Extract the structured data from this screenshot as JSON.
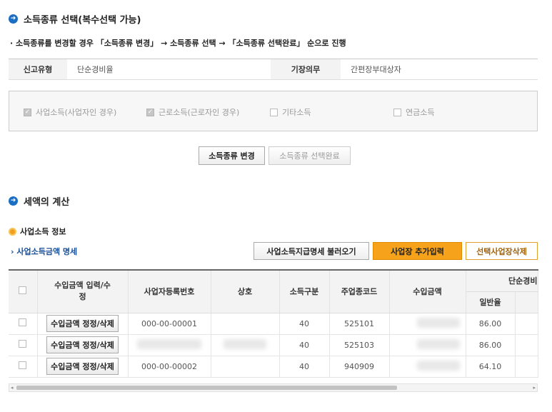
{
  "section1": {
    "title": "소득종류 선택(복수선택 가능)"
  },
  "notice": "· 소득종류를 변경할 경우 「소득종류 변경」 → 소득종류 선택 → 「소득종류 선택완료」 순으로 진행",
  "info": {
    "report_type_label": "신고유형",
    "report_type_value": "단순경비율",
    "bookkeeping_label": "기장의무",
    "bookkeeping_value": "간편장부대상자"
  },
  "income_types": [
    {
      "label": "사업소득(사업자인 경우)",
      "checked": true
    },
    {
      "label": "근로소득(근로자인 경우)",
      "checked": true
    },
    {
      "label": "기타소득",
      "checked": false
    },
    {
      "label": "연금소득",
      "checked": false
    }
  ],
  "buttons": {
    "change": "소득종류 변경",
    "complete": "소득종류 선택완료",
    "load_statement": "사업소득지급명세 불러오기",
    "add_business": "사업장 추가입력",
    "delete_business": "선택사업장삭제"
  },
  "section2": {
    "title": "세액의 계산"
  },
  "biz_info": {
    "title": "사업소득 정보",
    "link": "› 사업소득금액 명세"
  },
  "table": {
    "headers": {
      "revenue_edit": "수입금액 입력/수정",
      "reg_no": "사업자등록번호",
      "company": "상호",
      "income_class": "소득구분",
      "industry_code": "주업종코드",
      "revenue": "수입금액",
      "simple_expense": "단순경비",
      "general_rate": "일반율"
    },
    "rows": [
      {
        "edit_label": "수입금액 정정/삭제",
        "reg_no": "000-00-00001",
        "income_class": "40",
        "industry_code": "525101",
        "rate": "86.00"
      },
      {
        "edit_label": "수입금액 정정/삭제",
        "reg_no": "",
        "income_class": "40",
        "industry_code": "525103",
        "rate": "86.00"
      },
      {
        "edit_label": "수입금액 정정/삭제",
        "reg_no": "000-00-00002",
        "income_class": "40",
        "industry_code": "940909",
        "rate": "64.10"
      }
    ]
  },
  "colors": {
    "accent_blue": "#1b6ec2",
    "orange": "#f7a21b",
    "link_blue": "#1a4f97"
  }
}
